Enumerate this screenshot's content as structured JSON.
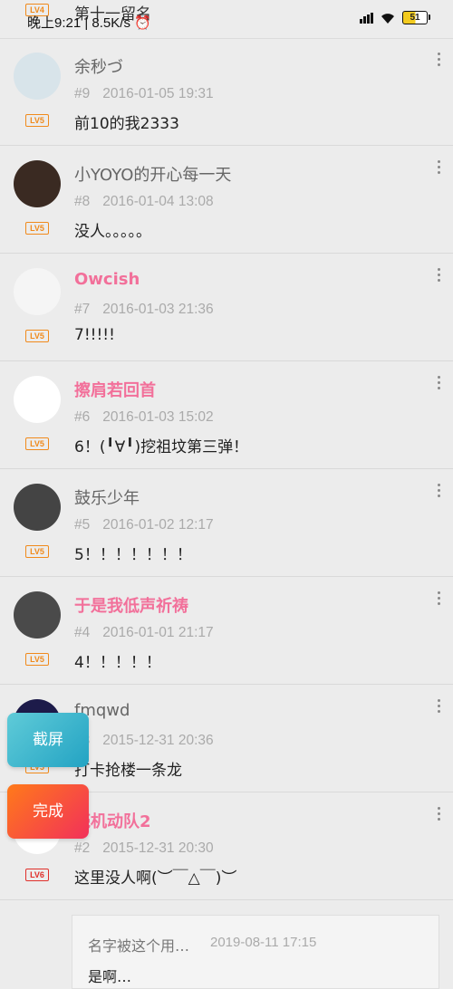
{
  "status_bar": {
    "time_speed": "晚上9:21 | 8.5K/s ⏰",
    "ghost_title": "第十一留名",
    "battery": "51",
    "top_level_badge": "LV4"
  },
  "comments": [
    {
      "name": "余秒づ",
      "pink": false,
      "level": "LV5",
      "floor": "#9",
      "time": "2016-01-05 19:31",
      "content": "前10的我2333",
      "avatar_color": "#d8e4ea"
    },
    {
      "name": "小YOYO的开心每一天",
      "pink": false,
      "level": "LV5",
      "floor": "#8",
      "time": "2016-01-04 13:08",
      "content": "没人。。。。。",
      "avatar_color": "#3a2a22"
    },
    {
      "name": "Owcish",
      "pink": true,
      "level": "LV5",
      "floor": "#7",
      "time": "2016-01-03 21:36",
      "content": "7!!!!!",
      "avatar_color": "#f5f5f5"
    },
    {
      "name": "擦肩若回首",
      "pink": true,
      "level": "LV5",
      "floor": "#6",
      "time": "2016-01-03 15:02",
      "content": "6！(╹∀╹)挖祖坟第三弹！",
      "avatar_color": "#ffffff"
    },
    {
      "name": "鼓乐少年",
      "pink": false,
      "level": "LV5",
      "floor": "#5",
      "time": "2016-01-02 12:17",
      "content": "5！！！！！！！",
      "avatar_color": "#444444"
    },
    {
      "name": "于是我低声祈祷",
      "pink": true,
      "level": "LV5",
      "floor": "#4",
      "time": "2016-01-01 21:17",
      "content": "4！！！！！",
      "avatar_color": "#4a4a4a"
    },
    {
      "name": "fmqwd",
      "pink": false,
      "level": "LV5",
      "floor": "#3",
      "time": "2015-12-31 20:36",
      "content": "打卡抢楼一条龙",
      "avatar_color": "#1d1b4a"
    },
    {
      "name": "壳机动队2",
      "pink": true,
      "level": "LV6",
      "floor": "#2",
      "time": "2015-12-31 20:30",
      "content": "这里没人啊(︶￣△￣)︶",
      "avatar_color": "#ffffff"
    }
  ],
  "reply": {
    "name": "名字被这个用…",
    "time": "2019-08-11 17:15",
    "text": "是啊…"
  },
  "floating": {
    "screenshot_label": "截屏",
    "done_label": "完成"
  },
  "colors": {
    "pink_name": "#f2709a",
    "level_orange": "#f08a1c",
    "level_red": "#e0302b"
  }
}
